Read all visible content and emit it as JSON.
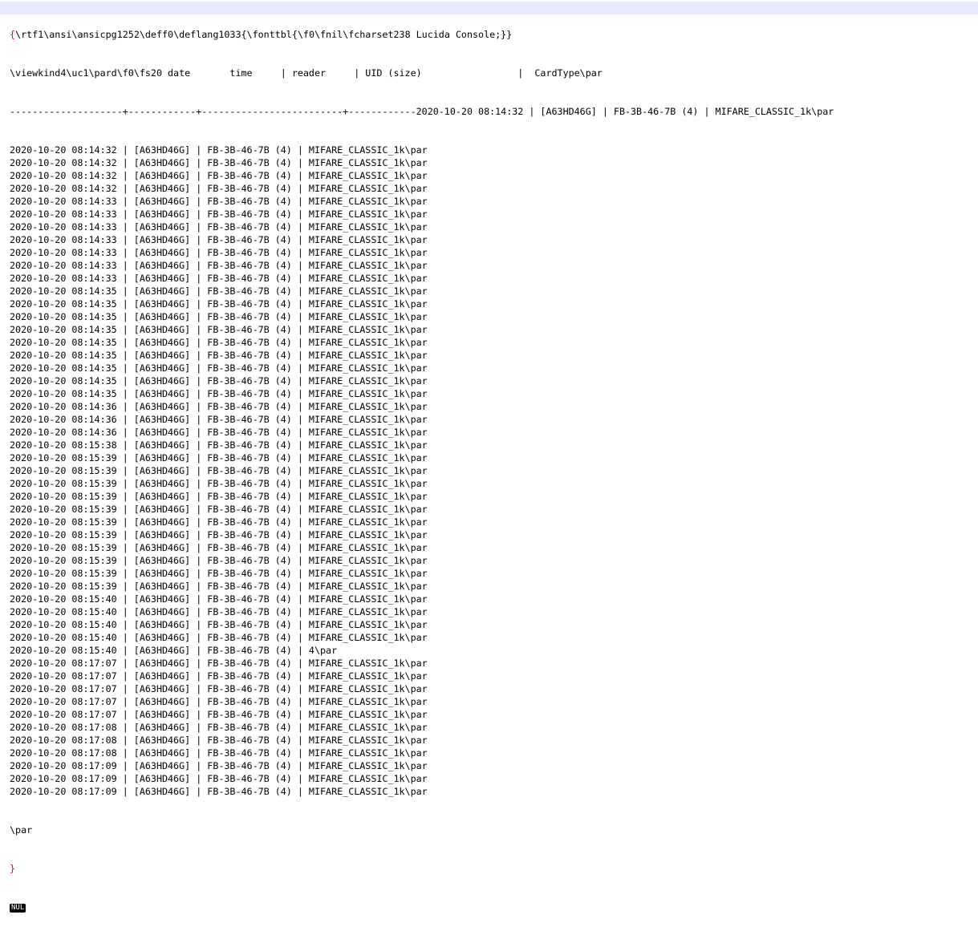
{
  "document": {
    "line1": {
      "brace_open": "{",
      "text": "\\rtf1\\ansi\\ansicpg1252\\deff0\\deflang1033{\\fonttbl{\\f0\\fnil\\fcharset238 Lucida Console;}}"
    },
    "line2": "\\viewkind4\\uc1\\pard\\f0\\fs20 date       time     | reader     | UID (size)                 |  CardType\\par",
    "line3": "--------------------+------------+-------------------------+------------2020-10-20 08:14:32 | [A63HD46G] | FB-3B-46-7B (4) | MIFARE_CLASSIC_1k\\par",
    "rows": [
      "2020-10-20 08:14:32 | [A63HD46G] | FB-3B-46-7B (4) | MIFARE_CLASSIC_1k\\par",
      "2020-10-20 08:14:32 | [A63HD46G] | FB-3B-46-7B (4) | MIFARE_CLASSIC_1k\\par",
      "2020-10-20 08:14:32 | [A63HD46G] | FB-3B-46-7B (4) | MIFARE_CLASSIC_1k\\par",
      "2020-10-20 08:14:32 | [A63HD46G] | FB-3B-46-7B (4) | MIFARE_CLASSIC_1k\\par",
      "2020-10-20 08:14:33 | [A63HD46G] | FB-3B-46-7B (4) | MIFARE_CLASSIC_1k\\par",
      "2020-10-20 08:14:33 | [A63HD46G] | FB-3B-46-7B (4) | MIFARE_CLASSIC_1k\\par",
      "2020-10-20 08:14:33 | [A63HD46G] | FB-3B-46-7B (4) | MIFARE_CLASSIC_1k\\par",
      "2020-10-20 08:14:33 | [A63HD46G] | FB-3B-46-7B (4) | MIFARE_CLASSIC_1k\\par",
      "2020-10-20 08:14:33 | [A63HD46G] | FB-3B-46-7B (4) | MIFARE_CLASSIC_1k\\par",
      "2020-10-20 08:14:33 | [A63HD46G] | FB-3B-46-7B (4) | MIFARE_CLASSIC_1k\\par",
      "2020-10-20 08:14:33 | [A63HD46G] | FB-3B-46-7B (4) | MIFARE_CLASSIC_1k\\par",
      "2020-10-20 08:14:35 | [A63HD46G] | FB-3B-46-7B (4) | MIFARE_CLASSIC_1k\\par",
      "2020-10-20 08:14:35 | [A63HD46G] | FB-3B-46-7B (4) | MIFARE_CLASSIC_1k\\par",
      "2020-10-20 08:14:35 | [A63HD46G] | FB-3B-46-7B (4) | MIFARE_CLASSIC_1k\\par",
      "2020-10-20 08:14:35 | [A63HD46G] | FB-3B-46-7B (4) | MIFARE_CLASSIC_1k\\par",
      "2020-10-20 08:14:35 | [A63HD46G] | FB-3B-46-7B (4) | MIFARE_CLASSIC_1k\\par",
      "2020-10-20 08:14:35 | [A63HD46G] | FB-3B-46-7B (4) | MIFARE_CLASSIC_1k\\par",
      "2020-10-20 08:14:35 | [A63HD46G] | FB-3B-46-7B (4) | MIFARE_CLASSIC_1k\\par",
      "2020-10-20 08:14:35 | [A63HD46G] | FB-3B-46-7B (4) | MIFARE_CLASSIC_1k\\par",
      "2020-10-20 08:14:35 | [A63HD46G] | FB-3B-46-7B (4) | MIFARE_CLASSIC_1k\\par",
      "2020-10-20 08:14:36 | [A63HD46G] | FB-3B-46-7B (4) | MIFARE_CLASSIC_1k\\par",
      "2020-10-20 08:14:36 | [A63HD46G] | FB-3B-46-7B (4) | MIFARE_CLASSIC_1k\\par",
      "2020-10-20 08:14:36 | [A63HD46G] | FB-3B-46-7B (4) | MIFARE_CLASSIC_1k\\par",
      "2020-10-20 08:15:38 | [A63HD46G] | FB-3B-46-7B (4) | MIFARE_CLASSIC_1k\\par",
      "2020-10-20 08:15:39 | [A63HD46G] | FB-3B-46-7B (4) | MIFARE_CLASSIC_1k\\par",
      "2020-10-20 08:15:39 | [A63HD46G] | FB-3B-46-7B (4) | MIFARE_CLASSIC_1k\\par",
      "2020-10-20 08:15:39 | [A63HD46G] | FB-3B-46-7B (4) | MIFARE_CLASSIC_1k\\par",
      "2020-10-20 08:15:39 | [A63HD46G] | FB-3B-46-7B (4) | MIFARE_CLASSIC_1k\\par",
      "2020-10-20 08:15:39 | [A63HD46G] | FB-3B-46-7B (4) | MIFARE_CLASSIC_1k\\par",
      "2020-10-20 08:15:39 | [A63HD46G] | FB-3B-46-7B (4) | MIFARE_CLASSIC_1k\\par",
      "2020-10-20 08:15:39 | [A63HD46G] | FB-3B-46-7B (4) | MIFARE_CLASSIC_1k\\par",
      "2020-10-20 08:15:39 | [A63HD46G] | FB-3B-46-7B (4) | MIFARE_CLASSIC_1k\\par",
      "2020-10-20 08:15:39 | [A63HD46G] | FB-3B-46-7B (4) | MIFARE_CLASSIC_1k\\par",
      "2020-10-20 08:15:39 | [A63HD46G] | FB-3B-46-7B (4) | MIFARE_CLASSIC_1k\\par",
      "2020-10-20 08:15:39 | [A63HD46G] | FB-3B-46-7B (4) | MIFARE_CLASSIC_1k\\par",
      "2020-10-20 08:15:40 | [A63HD46G] | FB-3B-46-7B (4) | MIFARE_CLASSIC_1k\\par",
      "2020-10-20 08:15:40 | [A63HD46G] | FB-3B-46-7B (4) | MIFARE_CLASSIC_1k\\par",
      "2020-10-20 08:15:40 | [A63HD46G] | FB-3B-46-7B (4) | MIFARE_CLASSIC_1k\\par",
      "2020-10-20 08:15:40 | [A63HD46G] | FB-3B-46-7B (4) | MIFARE_CLASSIC_1k\\par",
      "2020-10-20 08:15:40 | [A63HD46G] | FB-3B-46-7B (4) | 4\\par",
      "2020-10-20 08:17:07 | [A63HD46G] | FB-3B-46-7B (4) | MIFARE_CLASSIC_1k\\par",
      "2020-10-20 08:17:07 | [A63HD46G] | FB-3B-46-7B (4) | MIFARE_CLASSIC_1k\\par",
      "2020-10-20 08:17:07 | [A63HD46G] | FB-3B-46-7B (4) | MIFARE_CLASSIC_1k\\par",
      "2020-10-20 08:17:07 | [A63HD46G] | FB-3B-46-7B (4) | MIFARE_CLASSIC_1k\\par",
      "2020-10-20 08:17:07 | [A63HD46G] | FB-3B-46-7B (4) | MIFARE_CLASSIC_1k\\par",
      "2020-10-20 08:17:08 | [A63HD46G] | FB-3B-46-7B (4) | MIFARE_CLASSIC_1k\\par",
      "2020-10-20 08:17:08 | [A63HD46G] | FB-3B-46-7B (4) | MIFARE_CLASSIC_1k\\par",
      "2020-10-20 08:17:08 | [A63HD46G] | FB-3B-46-7B (4) | MIFARE_CLASSIC_1k\\par",
      "2020-10-20 08:17:09 | [A63HD46G] | FB-3B-46-7B (4) | MIFARE_CLASSIC_1k\\par",
      "2020-10-20 08:17:09 | [A63HD46G] | FB-3B-46-7B (4) | MIFARE_CLASSIC_1k\\par",
      "2020-10-20 08:17:09 | [A63HD46G] | FB-3B-46-7B (4) | MIFARE_CLASSIC_1k\\par"
    ],
    "par_line": "\\par",
    "brace_close": "}",
    "nul_badge": "NUL"
  },
  "colors": {
    "current_line_highlight": "#e8e8ff",
    "brace_match": "#ff0000",
    "text": "#000000",
    "nul_badge_bg": "#000000"
  }
}
